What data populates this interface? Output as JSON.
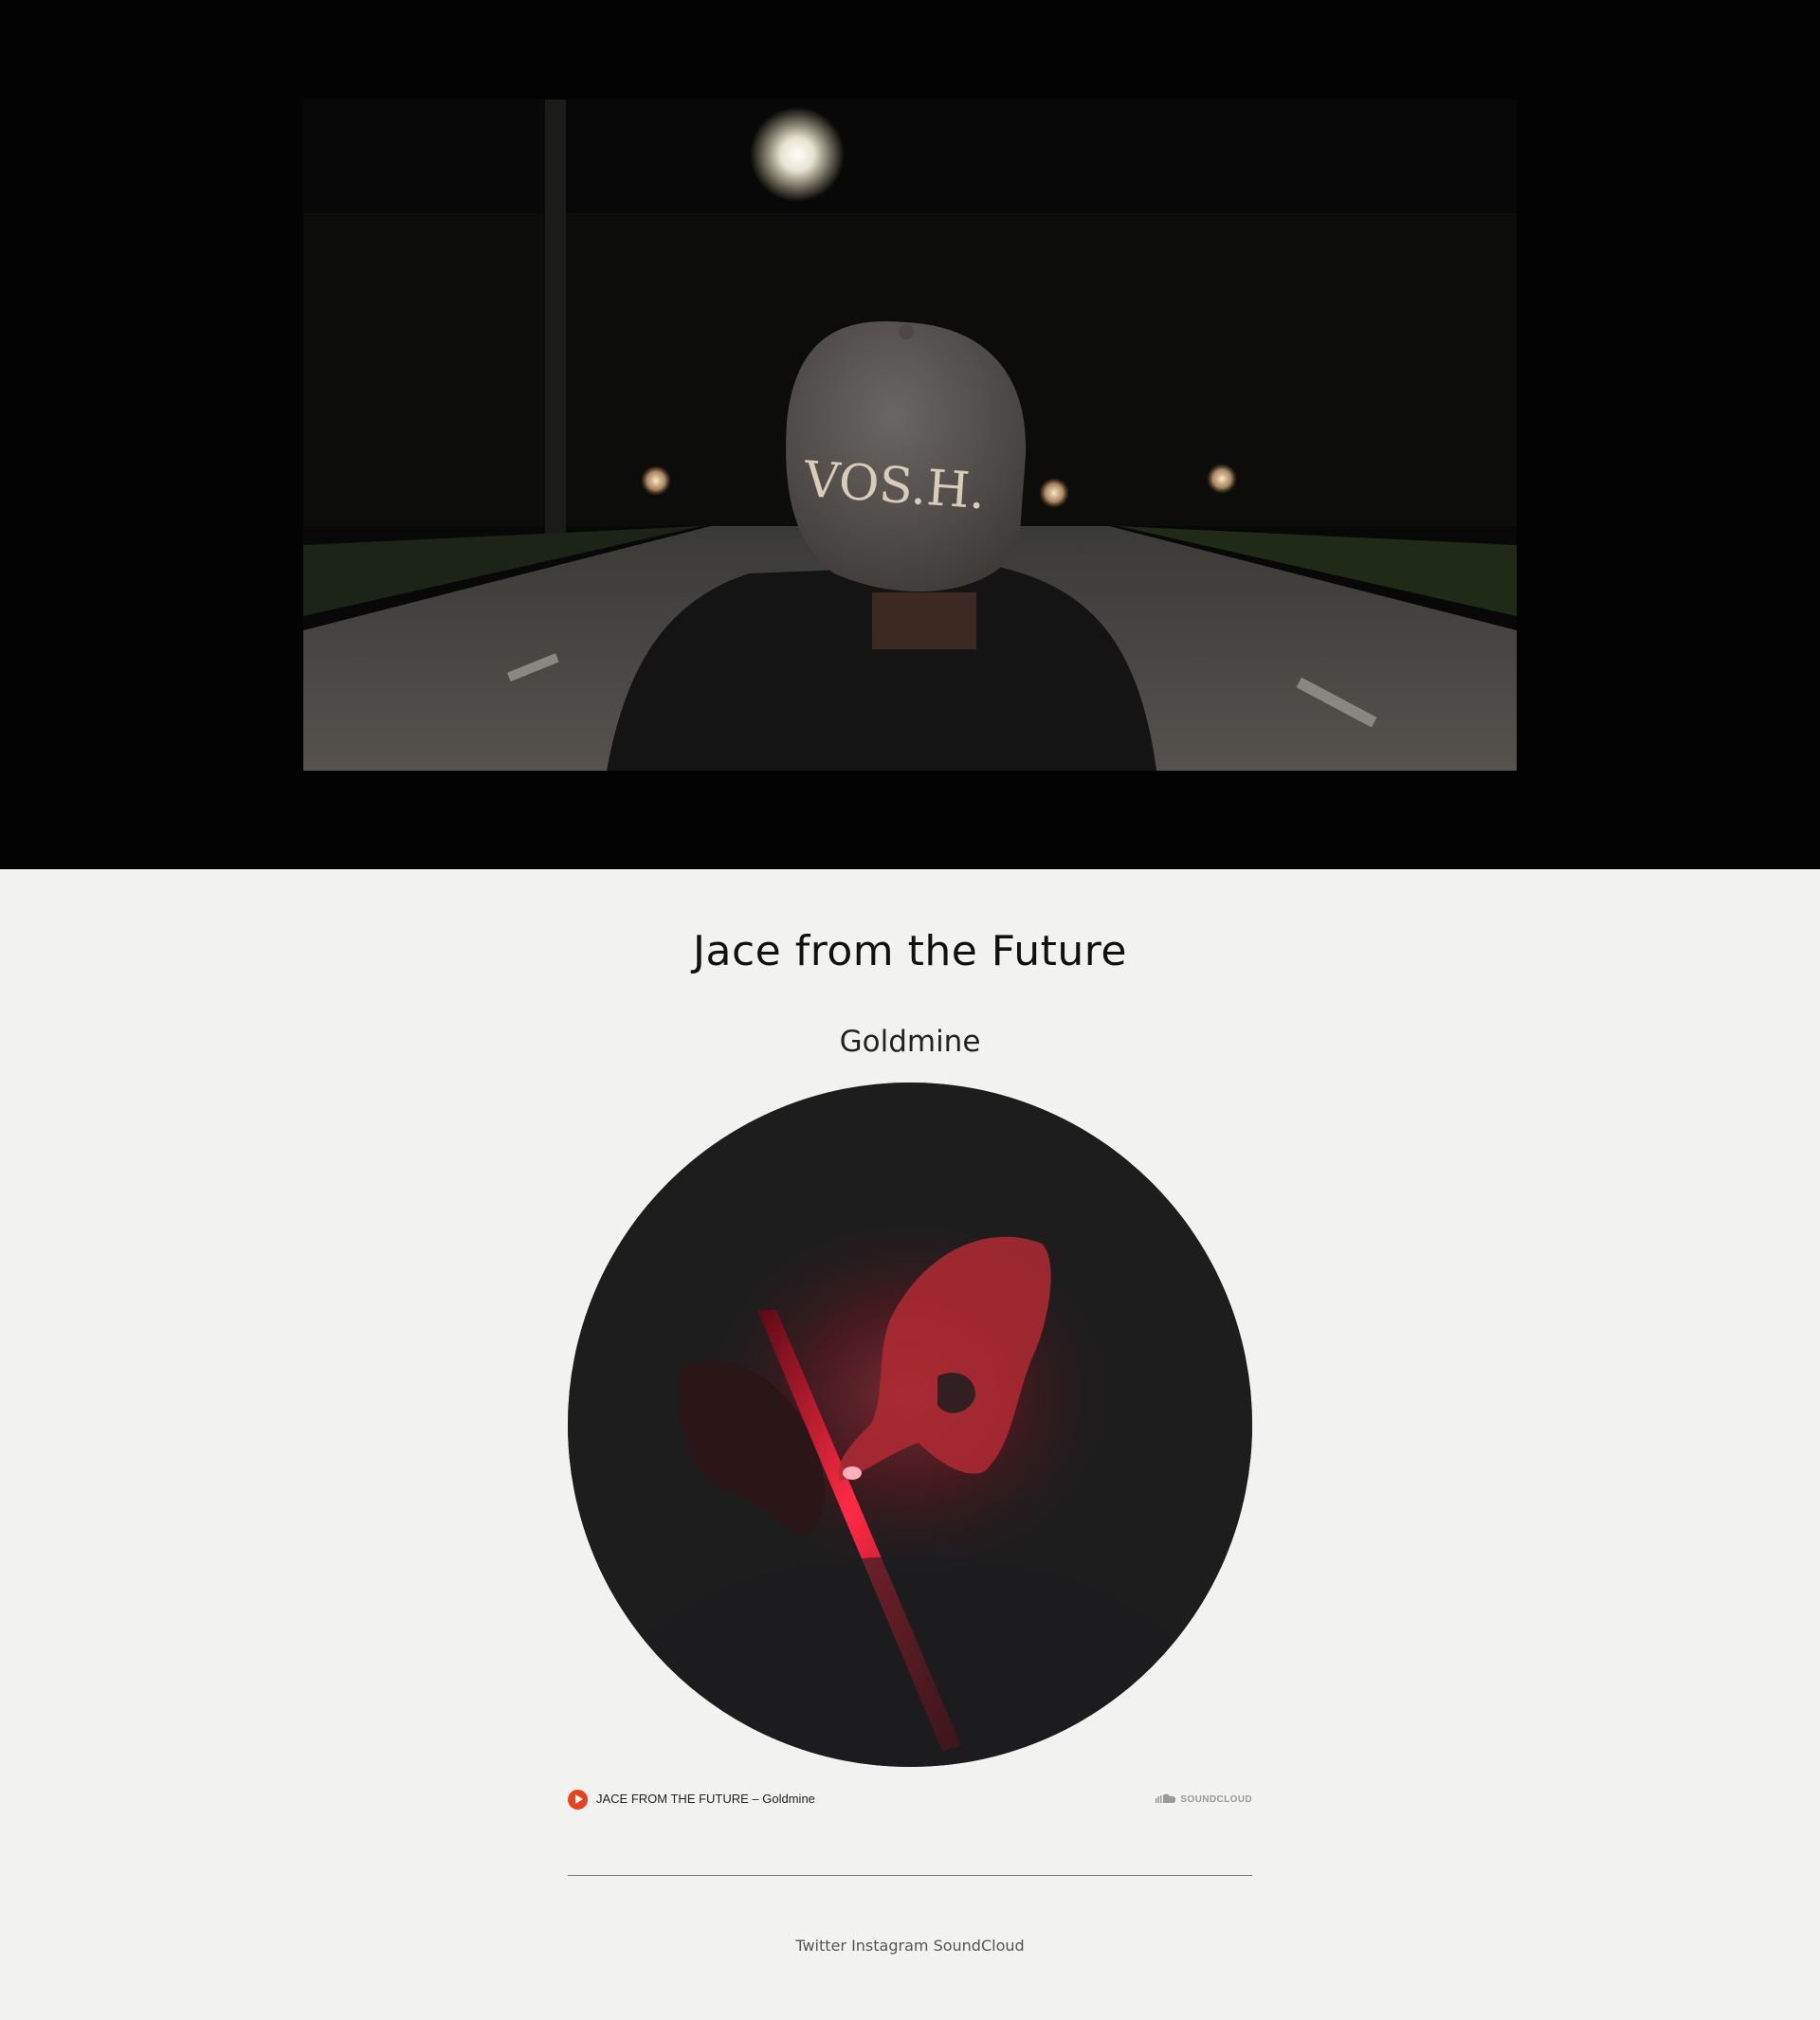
{
  "hero": {
    "cap_text": "VOS.H."
  },
  "artist": {
    "name": "Jace from the Future"
  },
  "track": {
    "title": "Goldmine"
  },
  "player": {
    "track_line": "JACE FROM THE FUTURE – Goldmine",
    "brand": "SOUNDCLOUD",
    "accent_color": "#e8431f"
  },
  "footer": {
    "links": [
      "Twitter",
      "Instagram",
      "SoundCloud"
    ]
  },
  "colors": {
    "hero_background": "#030303",
    "page_background": "#f2f2f1",
    "artwork_background": "#1d1d1e"
  }
}
